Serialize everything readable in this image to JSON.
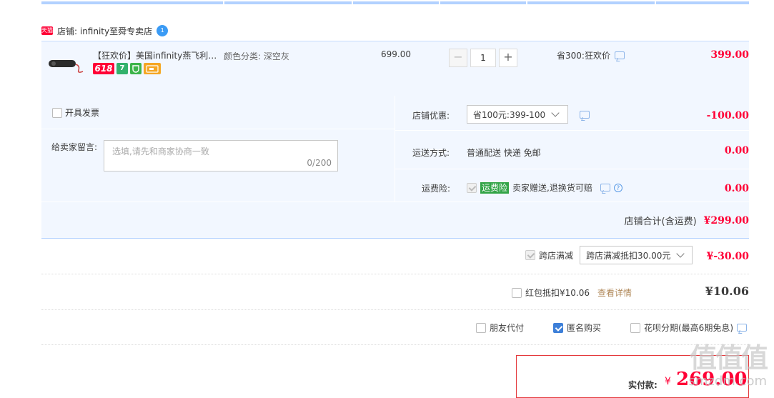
{
  "shop": {
    "badge": "天猫",
    "name": "店铺: infinity至舜专卖店",
    "wang": "1"
  },
  "item": {
    "title": "【狂欢价】美国infinity燕飞利仕 蓝牙音箱",
    "tags": [
      "618",
      "7"
    ],
    "sku": "颜色分类: 深空灰",
    "unit_price": "699.00",
    "quantity": "1",
    "minus": "−",
    "plus": "+",
    "promo": "省300:狂欢价",
    "subtotal": "399.00"
  },
  "options": {
    "invoice_label": "开具发票",
    "message_label": "给卖家留言:",
    "message_placeholder": "选填,请先和商家协商一致",
    "message_count": "0/200",
    "shop_discount_label": "店铺优惠:",
    "shop_discount_value": "省100元:399-100",
    "shop_discount_amount": "-100.00",
    "shipping_label": "运送方式:",
    "shipping_value": "普通配送 快递 免邮",
    "shipping_amount": "0.00",
    "insurance_label": "运费险:",
    "insurance_badge": "运费险",
    "insurance_text": "卖家赠送,退换货可赔",
    "insurance_amount": "0.00"
  },
  "shop_total": {
    "label": "店铺合计(含运费)",
    "amount": "¥299.00"
  },
  "cross_store": {
    "label": "跨店满减",
    "select": "跨店满减抵扣30.00元",
    "amount": "¥-30.00"
  },
  "red_packet": {
    "label": "红包抵扣¥10.06",
    "link": "查看详情",
    "amount": "¥10.06"
  },
  "pay_options": {
    "friend_pay": "朋友代付",
    "anonymous": "匿名购买",
    "huabei": "花呗分期(最高6期免息)"
  },
  "final": {
    "label": "实付款:",
    "currency": "¥",
    "amount": "269.00"
  },
  "watermark": {
    "text": "值值值",
    "url": "smzdm.com"
  }
}
